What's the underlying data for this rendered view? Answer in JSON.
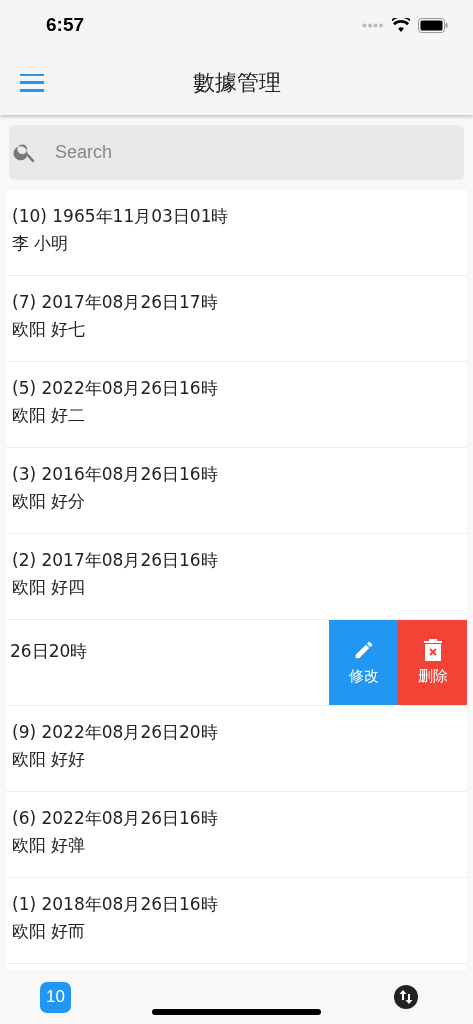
{
  "status_bar": {
    "time": "6:57"
  },
  "app_bar": {
    "title": "數據管理"
  },
  "search": {
    "placeholder": "Search"
  },
  "rows": [
    {
      "kind": "normal",
      "title": "(10) 1965年11月03日01時",
      "subtitle": "李 小明"
    },
    {
      "kind": "normal",
      "title": "(7) 2017年08月26日17時",
      "subtitle": "欧阳 好七"
    },
    {
      "kind": "normal",
      "title": "(5) 2022年08月26日16時",
      "subtitle": "欧阳 好二"
    },
    {
      "kind": "normal",
      "title": "(3) 2016年08月26日16時",
      "subtitle": "欧阳 好分"
    },
    {
      "kind": "normal",
      "title": "(2) 2017年08月26日16時",
      "subtitle": "欧阳 好四"
    },
    {
      "kind": "swiped",
      "title": "26日20時",
      "actions": [
        {
          "kind": "edit",
          "label": "修改"
        },
        {
          "kind": "delete",
          "label": "删除"
        }
      ]
    },
    {
      "kind": "normal",
      "title": "(9) 2022年08月26日20時",
      "subtitle": "欧阳 好好"
    },
    {
      "kind": "normal",
      "title": "(6) 2022年08月26日16時",
      "subtitle": "欧阳 好弹"
    },
    {
      "kind": "normal",
      "title": "(1) 2018年08月26日16時",
      "subtitle": "欧阳 好而"
    }
  ],
  "bottom_bar": {
    "count": "10"
  }
}
